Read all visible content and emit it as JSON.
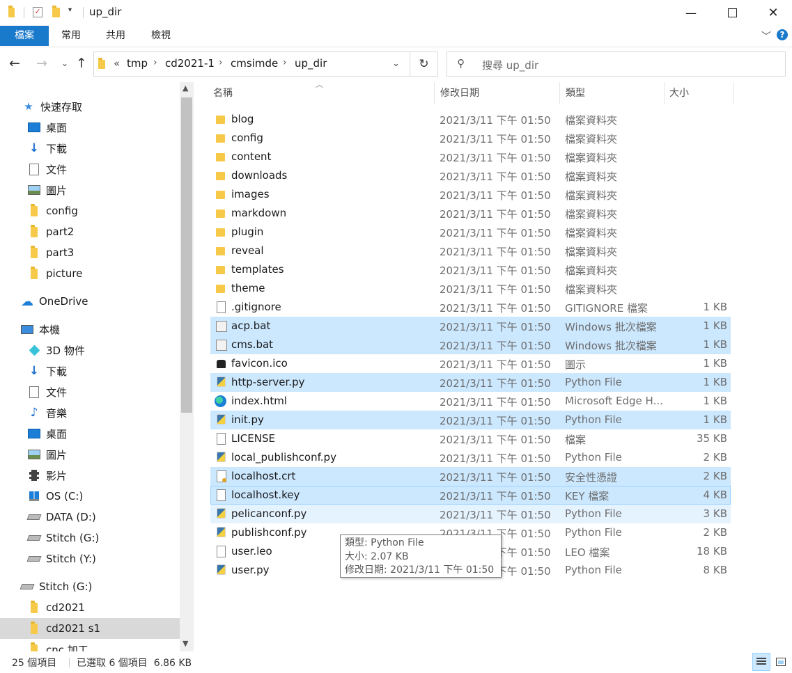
{
  "window": {
    "title": "up_dir"
  },
  "ribbon": {
    "tabs": [
      "檔案",
      "常用",
      "共用",
      "檢視"
    ]
  },
  "address": {
    "overflow": "«",
    "crumbs": [
      "tmp",
      "cd2021-1",
      "cmsimde",
      "up_dir"
    ],
    "search_placeholder": "搜尋 up_dir"
  },
  "nav": {
    "quick_access": "快速存取",
    "quick_items": [
      "桌面",
      "下載",
      "文件",
      "圖片"
    ],
    "folders": [
      "config",
      "part2",
      "part3",
      "picture"
    ],
    "onedrive": "OneDrive",
    "this_pc": "本機",
    "pc_items": [
      "3D 物件",
      "下載",
      "文件",
      "音樂",
      "桌面",
      "圖片",
      "影片"
    ],
    "drives": [
      "OS (C:)",
      "DATA (D:)",
      "Stitch (G:)",
      "Stitch (Y:)"
    ],
    "stitch": "Stitch (G:)",
    "stitch_items": [
      "cd2021",
      "cd2021 s1",
      "cnc 加工"
    ]
  },
  "columns": {
    "name": "名稱",
    "date": "修改日期",
    "type": "類型",
    "size": "大小"
  },
  "files": [
    {
      "name": "blog",
      "date": "2021/3/11 下午 01:50",
      "type": "檔案資料夾",
      "size": "",
      "icon": "folder-icon",
      "state": ""
    },
    {
      "name": "config",
      "date": "2021/3/11 下午 01:50",
      "type": "檔案資料夾",
      "size": "",
      "icon": "folder-icon",
      "state": ""
    },
    {
      "name": "content",
      "date": "2021/3/11 下午 01:50",
      "type": "檔案資料夾",
      "size": "",
      "icon": "folder-icon",
      "state": ""
    },
    {
      "name": "downloads",
      "date": "2021/3/11 下午 01:50",
      "type": "檔案資料夾",
      "size": "",
      "icon": "folder-icon",
      "state": ""
    },
    {
      "name": "images",
      "date": "2021/3/11 下午 01:50",
      "type": "檔案資料夾",
      "size": "",
      "icon": "folder-icon",
      "state": ""
    },
    {
      "name": "markdown",
      "date": "2021/3/11 下午 01:50",
      "type": "檔案資料夾",
      "size": "",
      "icon": "folder-icon",
      "state": ""
    },
    {
      "name": "plugin",
      "date": "2021/3/11 下午 01:50",
      "type": "檔案資料夾",
      "size": "",
      "icon": "folder-icon",
      "state": ""
    },
    {
      "name": "reveal",
      "date": "2021/3/11 下午 01:50",
      "type": "檔案資料夾",
      "size": "",
      "icon": "folder-icon",
      "state": ""
    },
    {
      "name": "templates",
      "date": "2021/3/11 下午 01:50",
      "type": "檔案資料夾",
      "size": "",
      "icon": "folder-icon",
      "state": ""
    },
    {
      "name": "theme",
      "date": "2021/3/11 下午 01:50",
      "type": "檔案資料夾",
      "size": "",
      "icon": "folder-icon",
      "state": ""
    },
    {
      "name": ".gitignore",
      "date": "2021/3/11 下午 01:50",
      "type": "GITIGNORE 檔案",
      "size": "1 KB",
      "icon": "file-icon",
      "state": ""
    },
    {
      "name": "acp.bat",
      "date": "2021/3/11 下午 01:50",
      "type": "Windows 批次檔案",
      "size": "1 KB",
      "icon": "bat-icon",
      "state": "sel"
    },
    {
      "name": "cms.bat",
      "date": "2021/3/11 下午 01:50",
      "type": "Windows 批次檔案",
      "size": "1 KB",
      "icon": "bat-icon",
      "state": "sel"
    },
    {
      "name": "favicon.ico",
      "date": "2021/3/11 下午 01:50",
      "type": "圖示",
      "size": "1 KB",
      "icon": "ico-icon",
      "state": ""
    },
    {
      "name": "http-server.py",
      "date": "2021/3/11 下午 01:50",
      "type": "Python File",
      "size": "1 KB",
      "icon": "python-icon",
      "state": "sel"
    },
    {
      "name": "index.html",
      "date": "2021/3/11 下午 01:50",
      "type": "Microsoft Edge H...",
      "size": "1 KB",
      "icon": "edge-icon",
      "state": ""
    },
    {
      "name": "init.py",
      "date": "2021/3/11 下午 01:50",
      "type": "Python File",
      "size": "1 KB",
      "icon": "python-icon",
      "state": "sel"
    },
    {
      "name": "LICENSE",
      "date": "2021/3/11 下午 01:50",
      "type": "檔案",
      "size": "35 KB",
      "icon": "file-icon",
      "state": ""
    },
    {
      "name": "local_publishconf.py",
      "date": "2021/3/11 下午 01:50",
      "type": "Python File",
      "size": "2 KB",
      "icon": "python-icon",
      "state": ""
    },
    {
      "name": "localhost.crt",
      "date": "2021/3/11 下午 01:50",
      "type": "安全性憑證",
      "size": "2 KB",
      "icon": "certificate-icon",
      "state": "sel"
    },
    {
      "name": "localhost.key",
      "date": "2021/3/11 下午 01:50",
      "type": "KEY 檔案",
      "size": "4 KB",
      "icon": "file-icon",
      "state": "focus"
    },
    {
      "name": "pelicanconf.py",
      "date": "2021/3/11 下午 01:50",
      "type": "Python File",
      "size": "3 KB",
      "icon": "python-icon",
      "state": "hover"
    },
    {
      "name": "publishconf.py",
      "date": "2021/3/11 下午 01:50",
      "type": "Python File",
      "size": "2 KB",
      "icon": "python-icon",
      "state": ""
    },
    {
      "name": "user.leo",
      "date": "2021/3/11 下午 01:50",
      "type": "LEO 檔案",
      "size": "18 KB",
      "icon": "file-icon",
      "state": ""
    },
    {
      "name": "user.py",
      "date": "2021/3/11 下午 01:50",
      "type": "Python File",
      "size": "8 KB",
      "icon": "python-icon",
      "state": ""
    }
  ],
  "tooltip": {
    "line1": "類型: Python File",
    "line2": "大小: 2.07 KB",
    "line3": "修改日期: 2021/3/11 下午 01:50"
  },
  "status": {
    "count": "25 個項目",
    "selected": "已選取 6 個項目  6.86 KB"
  },
  "colors": {
    "accent": "#1979ca",
    "selection": "#cce8ff",
    "hover": "#e5f3ff"
  }
}
